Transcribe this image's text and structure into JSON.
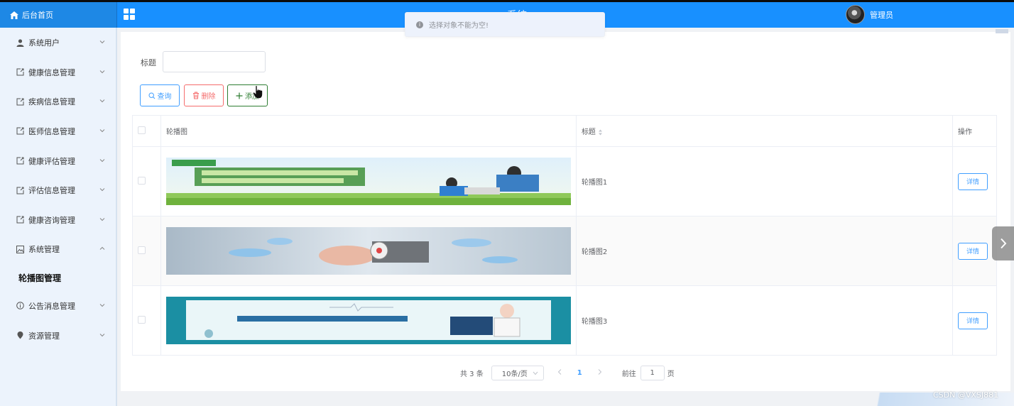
{
  "header": {
    "brand": "后台首页",
    "system_title": "…系统",
    "user_name": "管理员"
  },
  "toast": {
    "message": "选择对象不能为空!",
    "icon": "info-icon"
  },
  "sidebar": {
    "items": [
      {
        "label": "系统用户",
        "icon": "user-icon",
        "expanded": false
      },
      {
        "label": "健康信息管理",
        "icon": "share-icon",
        "expanded": false
      },
      {
        "label": "疾病信息管理",
        "icon": "share-icon",
        "expanded": false
      },
      {
        "label": "医师信息管理",
        "icon": "share-icon",
        "expanded": false
      },
      {
        "label": "健康评估管理",
        "icon": "share-icon",
        "expanded": false
      },
      {
        "label": "评估信息管理",
        "icon": "share-icon",
        "expanded": false
      },
      {
        "label": "健康咨询管理",
        "icon": "share-icon",
        "expanded": false
      },
      {
        "label": "系统管理",
        "icon": "picture-icon",
        "expanded": true
      },
      {
        "label": "轮播图管理",
        "submenu": true
      },
      {
        "label": "公告消息管理",
        "icon": "info-icon",
        "expanded": false
      },
      {
        "label": "资源管理",
        "icon": "location-icon",
        "expanded": false
      }
    ]
  },
  "search": {
    "label": "标题",
    "value": "",
    "placeholder": ""
  },
  "toolbar": {
    "query_label": "查询",
    "delete_label": "删除",
    "add_label": "添加"
  },
  "table": {
    "columns": {
      "image": "轮播图",
      "title": "标题",
      "action": "操作"
    },
    "rows": [
      {
        "title": "轮播图1",
        "action": "详情"
      },
      {
        "title": "轮播图2",
        "action": "详情"
      },
      {
        "title": "轮播图3",
        "action": "详情"
      }
    ]
  },
  "pagination": {
    "total": "共 3 条",
    "page_size": "10条/页",
    "current_page": "1",
    "goto_label": "前往",
    "goto_value": "1",
    "page_unit": "页"
  },
  "watermark": "CSDN @VXSJ881",
  "colors": {
    "primary": "#1890ff",
    "danger": "#f56c6c",
    "success": "#2e7d32",
    "sidebar_bg": "#ecf3fc"
  }
}
